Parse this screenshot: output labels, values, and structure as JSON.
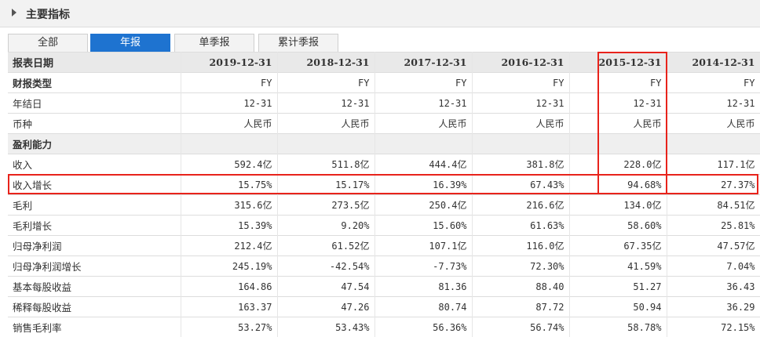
{
  "section_title": "主要指标",
  "tabs": [
    "全部",
    "年报",
    "单季报",
    "累计季报"
  ],
  "active_tab": "年报",
  "header_label": "报表日期",
  "dates": [
    "2019-12-31",
    "2018-12-31",
    "2017-12-31",
    "2016-12-31",
    "2015-12-31",
    "2014-12-31"
  ],
  "rows": [
    {
      "label": "财报类型",
      "values": [
        "FY",
        "FY",
        "FY",
        "FY",
        "FY",
        "FY"
      ],
      "bold": true
    },
    {
      "label": "年结日",
      "values": [
        "12-31",
        "12-31",
        "12-31",
        "12-31",
        "12-31",
        "12-31"
      ]
    },
    {
      "label": "币种",
      "values": [
        "人民币",
        "人民币",
        "人民币",
        "人民币",
        "人民币",
        "人民币"
      ]
    },
    {
      "label": "盈利能力",
      "section": true
    },
    {
      "label": "收入",
      "values": [
        "592.4亿",
        "511.8亿",
        "444.4亿",
        "381.8亿",
        "228.0亿",
        "117.1亿"
      ]
    },
    {
      "label": "收入增长",
      "values": [
        "15.75%",
        "15.17%",
        "16.39%",
        "67.43%",
        "94.68%",
        "27.37%"
      ]
    },
    {
      "label": "毛利",
      "values": [
        "315.6亿",
        "273.5亿",
        "250.4亿",
        "216.6亿",
        "134.0亿",
        "84.51亿"
      ]
    },
    {
      "label": "毛利增长",
      "values": [
        "15.39%",
        "9.20%",
        "15.60%",
        "61.63%",
        "58.60%",
        "25.81%"
      ]
    },
    {
      "label": "归母净利润",
      "values": [
        "212.4亿",
        "61.52亿",
        "107.1亿",
        "116.0亿",
        "67.35亿",
        "47.57亿"
      ]
    },
    {
      "label": "归母净利润增长",
      "values": [
        "245.19%",
        "-42.54%",
        "-7.73%",
        "72.30%",
        "41.59%",
        "7.04%"
      ]
    },
    {
      "label": "基本每股收益",
      "values": [
        "164.86",
        "47.54",
        "81.36",
        "88.40",
        "51.27",
        "36.43"
      ]
    },
    {
      "label": "稀释每股收益",
      "values": [
        "163.37",
        "47.26",
        "80.74",
        "87.72",
        "50.94",
        "36.29"
      ]
    },
    {
      "label": "销售毛利率",
      "values": [
        "53.27%",
        "53.43%",
        "56.36%",
        "56.74%",
        "58.78%",
        "72.15%"
      ]
    }
  ],
  "highlight_color": "#e8231b",
  "active_tab_color": "#1e73d0"
}
